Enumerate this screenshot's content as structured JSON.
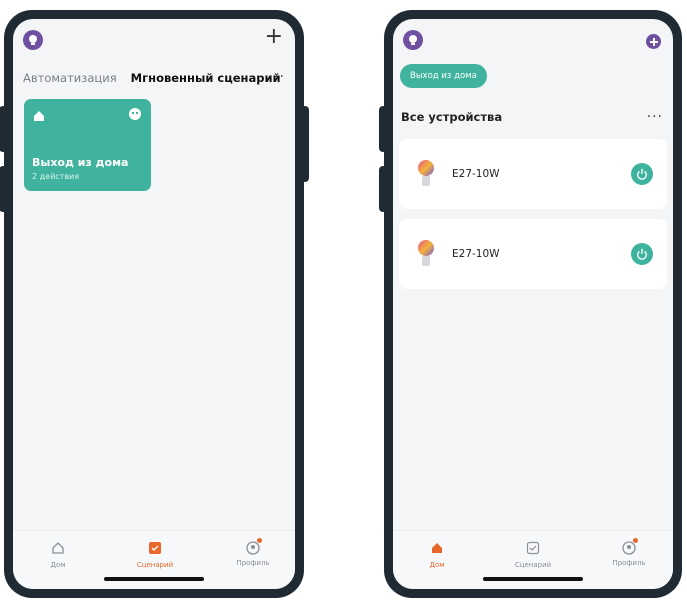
{
  "left": {
    "tabs": [
      "Автоматизация",
      "Мгновенный сценарий"
    ],
    "active_tab": 1,
    "scene": {
      "title": "Выход из дома",
      "subtitle": "2 действия"
    },
    "tabbar": [
      {
        "label": "Дом",
        "icon": "home-icon"
      },
      {
        "label": "Сценарий",
        "icon": "scene-icon"
      },
      {
        "label": "Профиль",
        "icon": "profile-icon"
      }
    ],
    "active_tabbar": 1
  },
  "right": {
    "scene_pill": "Выход из дома",
    "section_title": "Все устройства",
    "devices": [
      {
        "name": "E27-10W",
        "icon": "bulb-icon"
      },
      {
        "name": "E27-10W",
        "icon": "bulb-icon"
      }
    ],
    "tabbar": [
      {
        "label": "Дом",
        "icon": "home-icon"
      },
      {
        "label": "Сценарий",
        "icon": "scene-icon"
      },
      {
        "label": "Профиль",
        "icon": "profile-icon"
      }
    ],
    "active_tabbar": 0
  },
  "colors": {
    "accent": "#3fb39d",
    "active_tab": "#e8672a",
    "avatar": "#6e4fa0"
  }
}
